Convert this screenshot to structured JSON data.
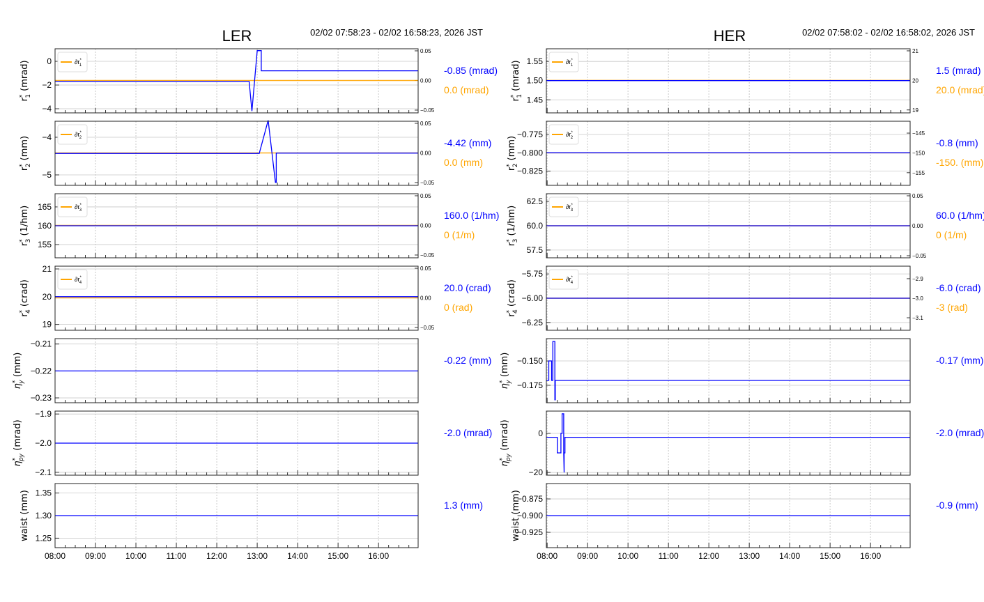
{
  "colors": {
    "main": "#0000ff",
    "ref": "#ffa500",
    "grid": "#c8c8c8"
  },
  "chart_data": [
    {
      "id": "LER",
      "title": "LER",
      "date_range": "02/02 07:58:23 - 02/02 16:58:23, 2026 JST",
      "type": "line",
      "xlim": [
        8.0,
        16.98
      ],
      "xticks": [
        8,
        9,
        10,
        11,
        12,
        13,
        14,
        15,
        16
      ],
      "xtick_labels": [
        "08:00",
        "09:00",
        "10:00",
        "11:00",
        "12:00",
        "13:00",
        "14:00",
        "15:00",
        "16:00"
      ],
      "panels": [
        {
          "ylabel": {
            "sym": "r",
            "sub": "1",
            "unit": "(mrad)"
          },
          "ylim": [
            -4.35,
            1.06
          ],
          "yticks": [
            0,
            -2,
            -4
          ],
          "ytick_labels": [
            "0",
            "−2",
            "−4"
          ],
          "series": {
            "x": [
              8.0,
              12.8,
              12.87,
              13.0,
              13.1,
              13.1,
              16.98
            ],
            "y": [
              -1.7,
              -1.7,
              -4.2,
              0.9,
              0.9,
              -0.8,
              -0.8
            ]
          },
          "ref": {
            "legend": {
              "sym": "∂r",
              "sub": "1"
            },
            "ylim": [
              -0.0547,
              0.0535
            ],
            "yticks": [
              0.05,
              0,
              -0.05
            ],
            "ytick_labels": [
              "0.05",
              "0.00",
              "−0.05"
            ],
            "value": 0
          },
          "value_main": "-0.85 (mrad)",
          "value_ref": "0.0 (mrad)"
        },
        {
          "ylabel": {
            "sym": "r",
            "sub": "2",
            "unit": "(mm)"
          },
          "ylim": [
            -5.278,
            -3.574
          ],
          "yticks": [
            -4,
            -5
          ],
          "ytick_labels": [
            "−4",
            "−5"
          ],
          "series": {
            "x": [
              8.0,
              13.05,
              13.27,
              13.45,
              13.47,
              13.47,
              16.98
            ],
            "y": [
              -4.43,
              -4.43,
              -3.55,
              -5.2,
              -5.2,
              -4.42,
              -4.42
            ]
          },
          "ref": {
            "legend": {
              "sym": "∂r",
              "sub": "2"
            },
            "ylim": [
              -0.0547,
              0.0535
            ],
            "yticks": [
              0.05,
              0,
              -0.05
            ],
            "ytick_labels": [
              "0.05",
              "0.00",
              "−0.05"
            ],
            "value": 0
          },
          "value_main": "-4.42 (mm)",
          "value_ref": "0.0 (mm)"
        },
        {
          "ylabel": {
            "sym": "r",
            "sub": "3",
            "unit": "(1/hm)"
          },
          "ylim": [
            151.5,
            168.5
          ],
          "yticks": [
            165,
            160,
            155
          ],
          "ytick_labels": [
            "165",
            "160",
            "155"
          ],
          "series": {
            "x": [
              8.0,
              16.98
            ],
            "y": [
              160,
              160
            ]
          },
          "ref": {
            "legend": {
              "sym": "∂r",
              "sub": "3"
            },
            "ylim": [
              -0.0547,
              0.0535
            ],
            "yticks": [
              0.05,
              0,
              -0.05
            ],
            "ytick_labels": [
              "0.05",
              "0.00",
              "−0.05"
            ],
            "value": 0
          },
          "value_main": "160.0 (1/hm)",
          "value_ref": "0 (1/m)"
        },
        {
          "ylabel": {
            "sym": "r",
            "sub": "4",
            "unit": "(crad)"
          },
          "ylim": [
            18.79,
            21.1
          ],
          "yticks": [
            21,
            20,
            19
          ],
          "ytick_labels": [
            "21",
            "20",
            "19"
          ],
          "series": {
            "x": [
              8.0,
              16.98
            ],
            "y": [
              20,
              20
            ]
          },
          "ref": {
            "legend": {
              "sym": "∂r",
              "sub": "4"
            },
            "ylim": [
              -0.0547,
              0.0535
            ],
            "yticks": [
              0.05,
              0,
              -0.05
            ],
            "ytick_labels": [
              "0.05",
              "0.00",
              "−0.05"
            ],
            "value": 0
          },
          "value_main": "20.0 (crad)",
          "value_ref": "0 (rad)"
        },
        {
          "ylabel": {
            "sym": "η",
            "sub": "y",
            "unit": "(mm)"
          },
          "ylim": [
            -0.2318,
            -0.208
          ],
          "yticks": [
            -0.21,
            -0.22,
            -0.23
          ],
          "ytick_labels": [
            "−0.21",
            "−0.22",
            "−0.23"
          ],
          "series": {
            "x": [
              8.0,
              16.98
            ],
            "y": [
              -0.22,
              -0.22
            ]
          },
          "value_main": "-0.22 (mm)"
        },
        {
          "ylabel": {
            "sym": "η",
            "sub": "py",
            "unit": "(mrad)"
          },
          "ylim": [
            -2.11,
            -1.89
          ],
          "yticks": [
            -1.9,
            -2.0,
            -2.1
          ],
          "ytick_labels": [
            "−1.9",
            "−2.0",
            "−2.1"
          ],
          "series": {
            "x": [
              8.0,
              16.98
            ],
            "y": [
              -2.0,
              -2.0
            ]
          },
          "value_main": "-2.0 (mrad)"
        },
        {
          "ylabel": {
            "sym": "waist",
            "sub": "",
            "unit": "(mm)",
            "plain": true
          },
          "ylim": [
            1.229,
            1.371
          ],
          "yticks": [
            1.35,
            1.3,
            1.25
          ],
          "ytick_labels": [
            "1.35",
            "1.30",
            "1.25"
          ],
          "series": {
            "x": [
              8.0,
              16.98
            ],
            "y": [
              1.3,
              1.3
            ]
          },
          "value_main": "1.3 (mm)"
        }
      ]
    },
    {
      "id": "HER",
      "title": "HER",
      "date_range": "02/02 07:58:02 - 02/02 16:58:02, 2026 JST",
      "type": "line",
      "xlim": [
        7.98,
        16.98
      ],
      "xticks": [
        8,
        9,
        10,
        11,
        12,
        13,
        14,
        15,
        16
      ],
      "xtick_labels": [
        "08:00",
        "09:00",
        "10:00",
        "11:00",
        "12:00",
        "13:00",
        "14:00",
        "15:00",
        "16:00"
      ],
      "panels": [
        {
          "ylabel": {
            "sym": "r",
            "sub": "1",
            "unit": "(mrad)"
          },
          "ylim": [
            1.416,
            1.583
          ],
          "yticks": [
            1.55,
            1.5,
            1.45
          ],
          "ytick_labels": [
            "1.55",
            "1.50",
            "1.45"
          ],
          "series": {
            "x": [
              7.98,
              16.98
            ],
            "y": [
              1.5,
              1.5
            ]
          },
          "ref": {
            "legend": {
              "sym": "∂r",
              "sub": "1"
            },
            "ylim": [
              18.9,
              21.07
            ],
            "yticks": [
              21,
              20,
              19
            ],
            "ytick_labels": [
              "21",
              "20",
              "19"
            ],
            "value": 20
          },
          "value_main": "1.5 (mrad)",
          "value_ref": "20.0 (mrad)"
        },
        {
          "ylabel": {
            "sym": "r",
            "sub": "2",
            "unit": "(mm)"
          },
          "ylim": [
            -0.8443,
            -0.757
          ],
          "yticks": [
            -0.775,
            -0.8,
            -0.825
          ],
          "ytick_labels": [
            "−0.775",
            "−0.800",
            "−0.825"
          ],
          "series": {
            "x": [
              7.98,
              16.98
            ],
            "y": [
              -0.8,
              -0.8
            ]
          },
          "ref": {
            "legend": {
              "sym": "∂r",
              "sub": "2"
            },
            "ylim": [
              -158.2,
              -142.0
            ],
            "yticks": [
              -145,
              -150,
              -155
            ],
            "ytick_labels": [
              "−145",
              "−150",
              "−155"
            ],
            "value": -150
          },
          "value_main": "-0.8 (mm)",
          "value_ref": "-150. (mm)"
        },
        {
          "ylabel": {
            "sym": "r",
            "sub": "3",
            "unit": "(1/hm)"
          },
          "ylim": [
            56.7,
            63.3
          ],
          "yticks": [
            62.5,
            60,
            57.5
          ],
          "ytick_labels": [
            "62.5",
            "60.0",
            "57.5"
          ],
          "series": {
            "x": [
              7.98,
              16.98
            ],
            "y": [
              60,
              60
            ]
          },
          "ref": {
            "legend": {
              "sym": "∂r",
              "sub": "3"
            },
            "ylim": [
              -0.0535,
              0.0535
            ],
            "yticks": [
              0.05,
              0,
              -0.05
            ],
            "ytick_labels": [
              "0.05",
              "0.00",
              "−0.05"
            ],
            "value": 0
          },
          "value_main": "60.0 (1/hm)",
          "value_ref": "0 (1/m)"
        },
        {
          "ylabel": {
            "sym": "r",
            "sub": "4",
            "unit": "(crad)"
          },
          "ylim": [
            -6.33,
            -5.67
          ],
          "yticks": [
            -5.75,
            -6.0,
            -6.25
          ],
          "ytick_labels": [
            "−5.75",
            "−6.00",
            "−6.25"
          ],
          "series": {
            "x": [
              7.98,
              16.98
            ],
            "y": [
              -6.0,
              -6.0
            ]
          },
          "ref": {
            "legend": {
              "sym": "∂r",
              "sub": "4"
            },
            "ylim": [
              -3.164,
              -2.836
            ],
            "yticks": [
              -2.9,
              -3.0,
              -3.1
            ],
            "ytick_labels": [
              "−2.9",
              "−3.0",
              "−3.1"
            ],
            "value": -3
          },
          "value_main": "-6.0 (crad)",
          "value_ref": "-3 (rad)"
        },
        {
          "ylabel": {
            "sym": "η",
            "sub": "y",
            "unit": "(mm)"
          },
          "ylim": [
            -0.1929,
            -0.1271
          ],
          "yticks": [
            -0.15,
            -0.175
          ],
          "ytick_labels": [
            "−0.150",
            "−0.175"
          ],
          "series": {
            "x": [
              7.98,
              8.04,
              8.04,
              8.11,
              8.11,
              8.14,
              8.14,
              8.19,
              8.19,
              8.2,
              8.2,
              16.98
            ],
            "y": [
              -0.17,
              -0.17,
              -0.15,
              -0.15,
              -0.17,
              -0.17,
              -0.13,
              -0.13,
              -0.19,
              -0.19,
              -0.17,
              -0.17
            ]
          },
          "value_main": "-0.17 (mm)"
        },
        {
          "ylabel": {
            "sym": "η",
            "sub": "py",
            "unit": "(mrad)"
          },
          "ylim": [
            -21.4,
            11.4
          ],
          "yticks": [
            0,
            -20
          ],
          "ytick_labels": [
            "0",
            "−20"
          ],
          "series": {
            "x": [
              7.98,
              8.25,
              8.25,
              8.34,
              8.34,
              8.37,
              8.37,
              8.41,
              8.41,
              8.42,
              8.42,
              8.44,
              8.44,
              16.98
            ],
            "y": [
              -2,
              -2,
              -10,
              -10,
              0,
              0,
              10,
              10,
              -10,
              -20,
              -10,
              -10,
              -2,
              -2
            ]
          },
          "value_main": "-2.0 (mrad)"
        },
        {
          "ylabel": {
            "sym": "waist",
            "sub": "",
            "unit": "(mm)",
            "plain": true
          },
          "ylim": [
            -0.9479,
            -0.852
          ],
          "yticks": [
            -0.875,
            -0.9,
            -0.925
          ],
          "ytick_labels": [
            "−0.875",
            "−0.900",
            "−0.925"
          ],
          "series": {
            "x": [
              7.98,
              16.98
            ],
            "y": [
              -0.9,
              -0.9
            ]
          },
          "value_main": "-0.9 (mm)"
        }
      ]
    }
  ]
}
